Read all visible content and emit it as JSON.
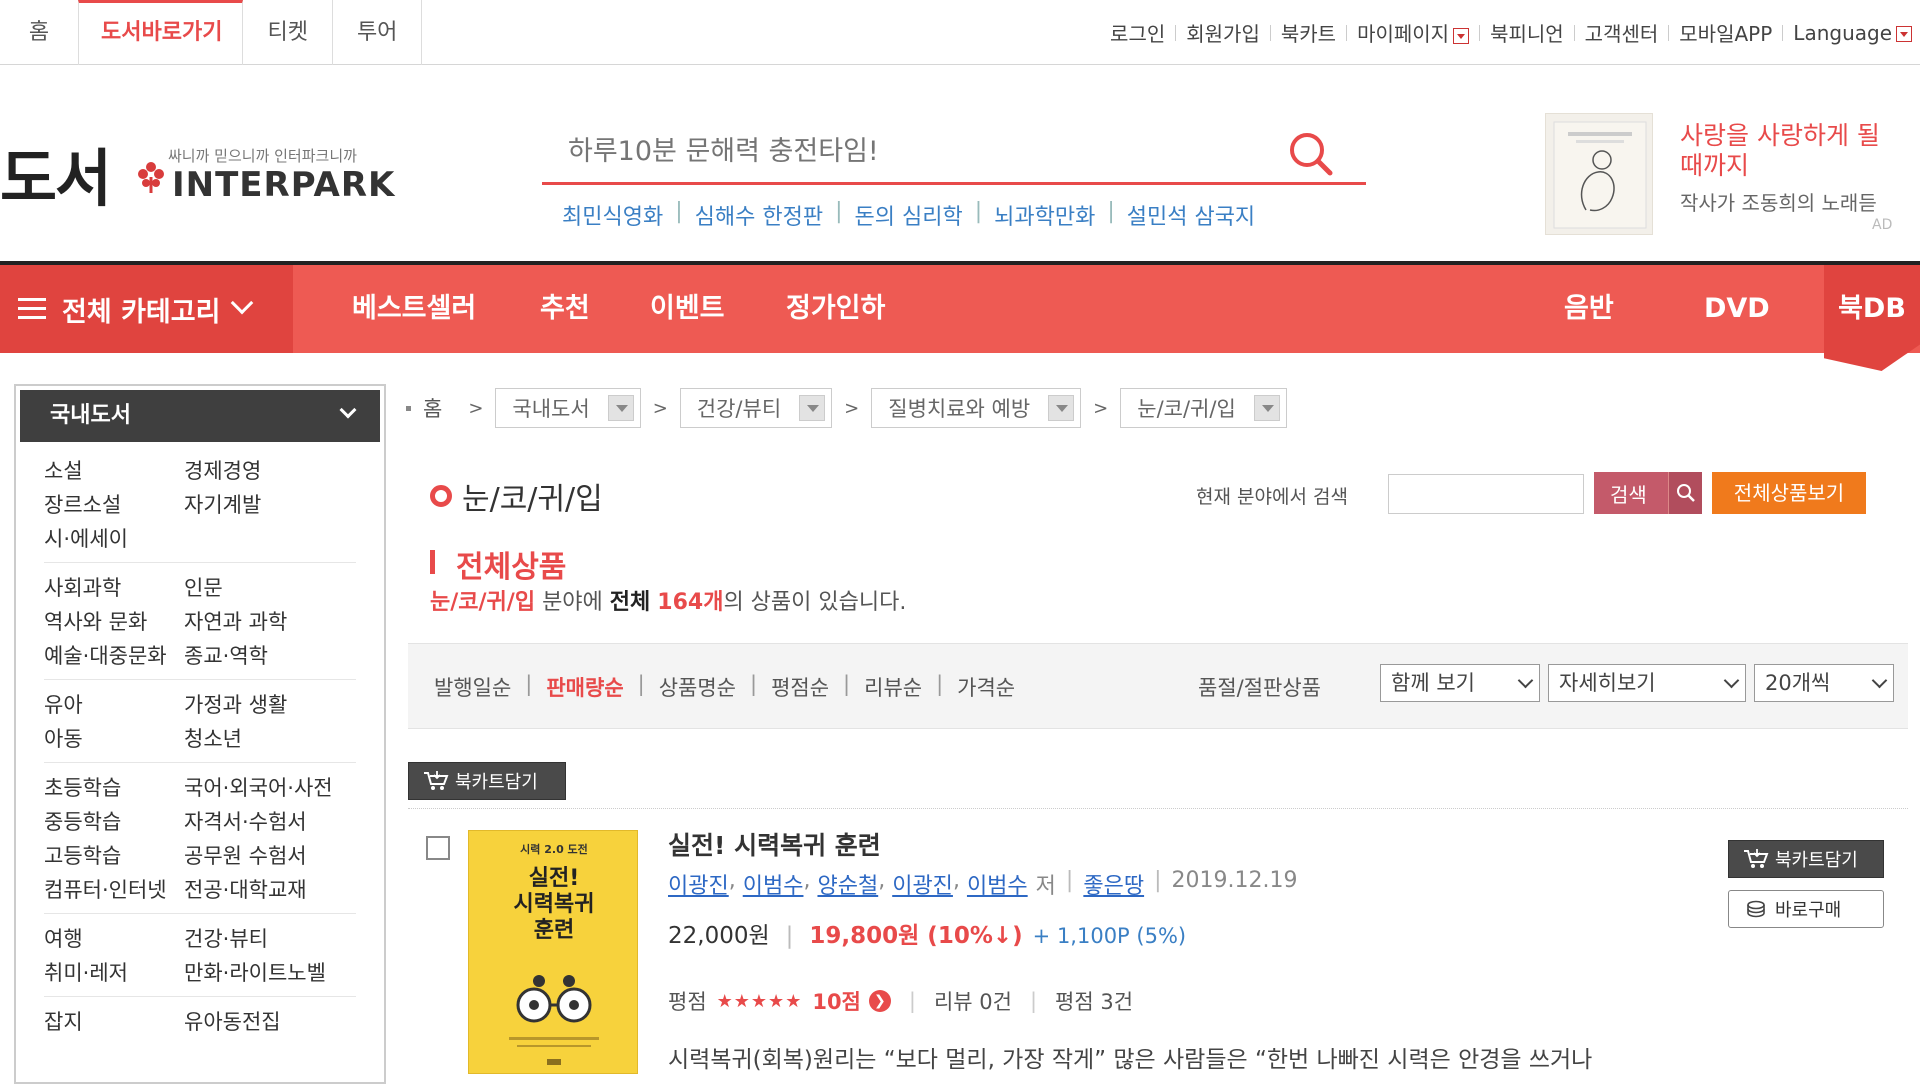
{
  "top": {
    "service_tabs": [
      "홈",
      "도서바로가기",
      "티켓",
      "투어"
    ],
    "util_links": [
      "로그인",
      "회원가입",
      "북카트",
      "마이페이지",
      "북피니언",
      "고객센터",
      "모바일APP",
      "Language"
    ]
  },
  "header": {
    "logo_text": "도서",
    "logo_slogan": "싸니까 믿으니까 인터파크니까",
    "logo_brand": "INTERPARK",
    "search_placeholder": "하루10분 문해력 충전타임!",
    "hot_keywords": [
      "최민식영화",
      "심해수 한정판",
      "돈의 심리학",
      "뇌과학만화",
      "설민석 삼국지"
    ],
    "ad": {
      "title": "사랑을 사랑하게 될때까지",
      "subtitle": "작사가 조동희의 노래듣",
      "badge": "AD"
    }
  },
  "gnb": {
    "category_label": "전체 카테고리",
    "items": [
      "베스트셀러",
      "추천",
      "이벤트",
      "정가인하"
    ],
    "right_items": [
      "음반",
      "DVD"
    ],
    "db_label": "북DB"
  },
  "sidebar": {
    "title": "국내도서",
    "groups": [
      [
        "소설",
        "경제경영",
        "장르소설",
        "자기계발",
        "시·에세이",
        ""
      ],
      [
        "사회과학",
        "인문",
        "역사와 문화",
        "자연과 과학",
        "예술·대중문화",
        "종교·역학"
      ],
      [
        "유아",
        "가정과 생활",
        "아동",
        "청소년"
      ],
      [
        "초등학습",
        "국어·외국어·사전",
        "중등학습",
        "자격서·수험서",
        "고등학습",
        "공무원 수험서",
        "컴퓨터·인터넷",
        "전공·대학교재"
      ],
      [
        "여행",
        "건강·뷰티",
        "취미·레저",
        "만화·라이트노벨"
      ],
      [
        "잡지",
        "유아동전집"
      ]
    ]
  },
  "breadcrumb": {
    "home": "홈",
    "levels": [
      "국내도서",
      "건강/뷰티",
      "질병치료와 예방",
      "눈/코/귀/입"
    ]
  },
  "category": {
    "title": "눈/코/귀/입",
    "field_search_label": "현재 분야에서 검색",
    "search_button": "검색",
    "all_button": "전체상품보기"
  },
  "summary": {
    "heading": "전체상품",
    "field": "눈/코/귀/입",
    "text1": " 분야에 ",
    "total_label": "전체",
    "count": "164개",
    "text2": "의 상품이 있습니다."
  },
  "sortbar": {
    "options": [
      "발행일순",
      "판매량순",
      "상품명순",
      "평점순",
      "리뷰순",
      "가격순"
    ],
    "active": "판매량순",
    "sold_out_label": "품절/절판상품",
    "view_mode": "함께 보기",
    "detail_mode": "자세히보기",
    "per_page": "20개씩"
  },
  "cart_button": "북카트담기",
  "item": {
    "title": "실전! 시력복귀 훈련",
    "authors": [
      "이광진",
      "이범수",
      "양순철",
      "이광진",
      "이범수"
    ],
    "author_suffix": "저",
    "publisher": "좋은땅",
    "date": "2019.12.19",
    "list_price": "22,000원",
    "sale_price": "19,800원 (10%↓)",
    "point": "+ 1,100P (5%)",
    "rating_label": "평점",
    "stars": "★★★★★",
    "score": "10점",
    "review": "리뷰 0건",
    "rating_count": "평점 3건",
    "desc": "시력복귀(회복)원리는 “보다 멀리, 가장 작게” 많은 사람들은 “한번 나빠진 시력은 안경을 쓰거나",
    "cart_label": "북카트담기",
    "buy_label": "바로구매",
    "cover_lines": [
      "시력 2.0 도전",
      "실전!",
      "시력복귀",
      "훈련"
    ]
  }
}
